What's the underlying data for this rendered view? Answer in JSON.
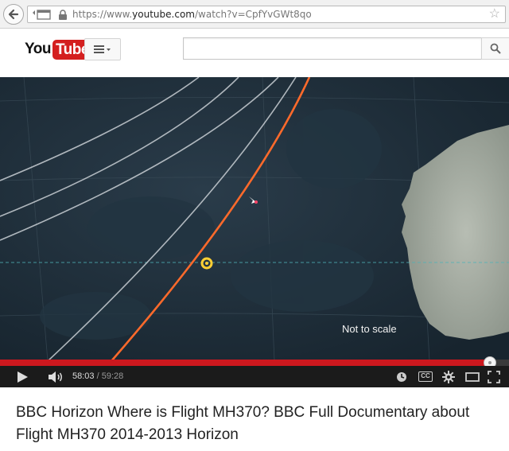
{
  "browser": {
    "url_prefix": "https://www.",
    "url_host": "youtube.com",
    "url_path": "/watch?v=CpfYvGWt8qo"
  },
  "header": {
    "logo_you": "You",
    "logo_tube": "Tube",
    "search_placeholder": ""
  },
  "video": {
    "caption": "Not to scale",
    "progress_fraction": 0.963
  },
  "player": {
    "current_time": "58:03",
    "separator": " / ",
    "duration": "59:28",
    "cc_label": "CC"
  },
  "title": "BBC Horizon Where is Flight MH370? BBC Full Documentary about Flight MH370 2014-2013 Horizon",
  "colors": {
    "progress_played": "#cc181e",
    "track_line": "#ff6a2b",
    "youtube_red": "#d41f1f"
  },
  "icons": [
    "back-arrow-icon",
    "apps-icon",
    "lock-icon",
    "star-icon",
    "guide-menu-icon",
    "search-icon",
    "play-icon",
    "volume-icon",
    "watch-later-icon",
    "cc-icon",
    "settings-icon",
    "theater-mode-icon",
    "fullscreen-icon"
  ]
}
